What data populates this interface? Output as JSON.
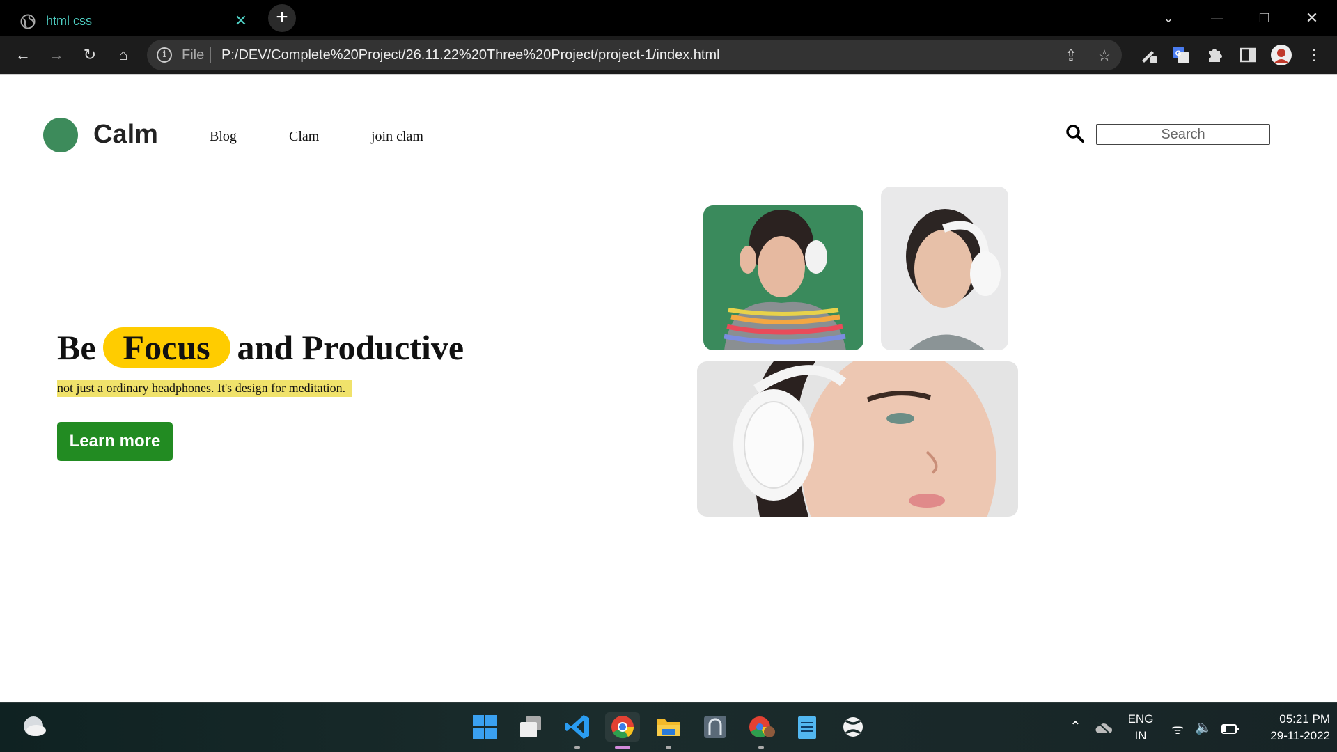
{
  "browser": {
    "tab_title": "html css",
    "omnibox": {
      "scheme_label": "File",
      "url": "P:/DEV/Complete%20Project/26.11.22%20Three%20Project/project-1/index.html"
    }
  },
  "page": {
    "logo_text": "Calm",
    "nav": [
      "Blog",
      "Clam",
      "join clam"
    ],
    "search_placeholder": "Search",
    "hero": {
      "before": "Be",
      "highlight": "Focus",
      "after": "and Productive",
      "subtext": "not just a ordinary headphones. It's design for meditation.",
      "cta": "Learn more"
    },
    "colors": {
      "logo": "#3d8b5b",
      "highlight": "#ffcc00",
      "subtext_bg": "#f0e26b",
      "cta": "#228b22"
    }
  },
  "taskbar": {
    "language": "ENG",
    "region": "IN",
    "time": "05:21 PM",
    "date": "29-11-2022"
  }
}
